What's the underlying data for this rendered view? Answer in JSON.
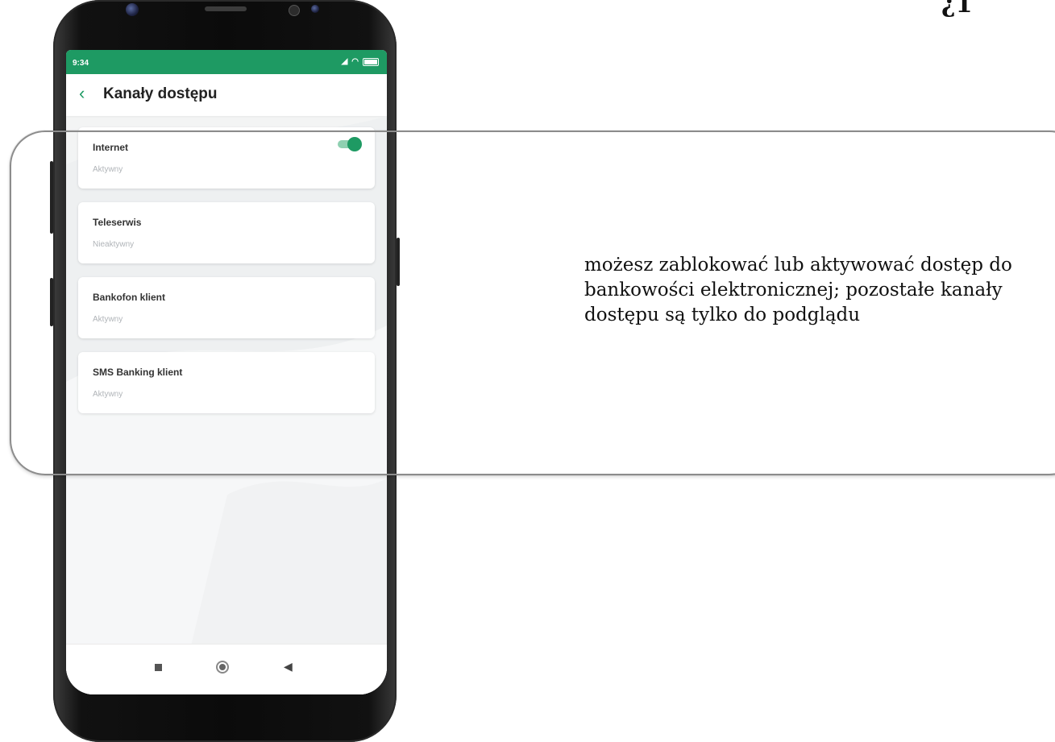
{
  "status_bar": {
    "time": "9:34",
    "signal_icon": "signal-icon",
    "wifi_icon": "wifi-icon",
    "battery_icon": "battery-icon"
  },
  "header": {
    "back_icon": "chevron-left-icon",
    "title": "Kanały dostępu"
  },
  "channels": [
    {
      "name": "Internet",
      "status": "Aktywny",
      "toggle": true,
      "toggle_on": true
    },
    {
      "name": "Teleserwis",
      "status": "Nieaktywny",
      "toggle": false
    },
    {
      "name": "Bankofon klient",
      "status": "Aktywny",
      "toggle": false
    },
    {
      "name": "SMS Banking klient",
      "status": "Aktywny",
      "toggle": false
    }
  ],
  "nav_bar": {
    "recents_icon": "square-icon",
    "home_icon": "circle-icon",
    "back_icon": "triangle-back-icon"
  },
  "callout": {
    "text": "możesz zablokować lub aktywować dostęp do bankowości elektronicznej; pozostałe kanały dostępu są tylko do podglądu"
  },
  "corner_mark": "¿1",
  "colors": {
    "accent": "#1e9a63",
    "toggle_track": "#8fd0b1",
    "callout_border": "#8c8c8c"
  }
}
